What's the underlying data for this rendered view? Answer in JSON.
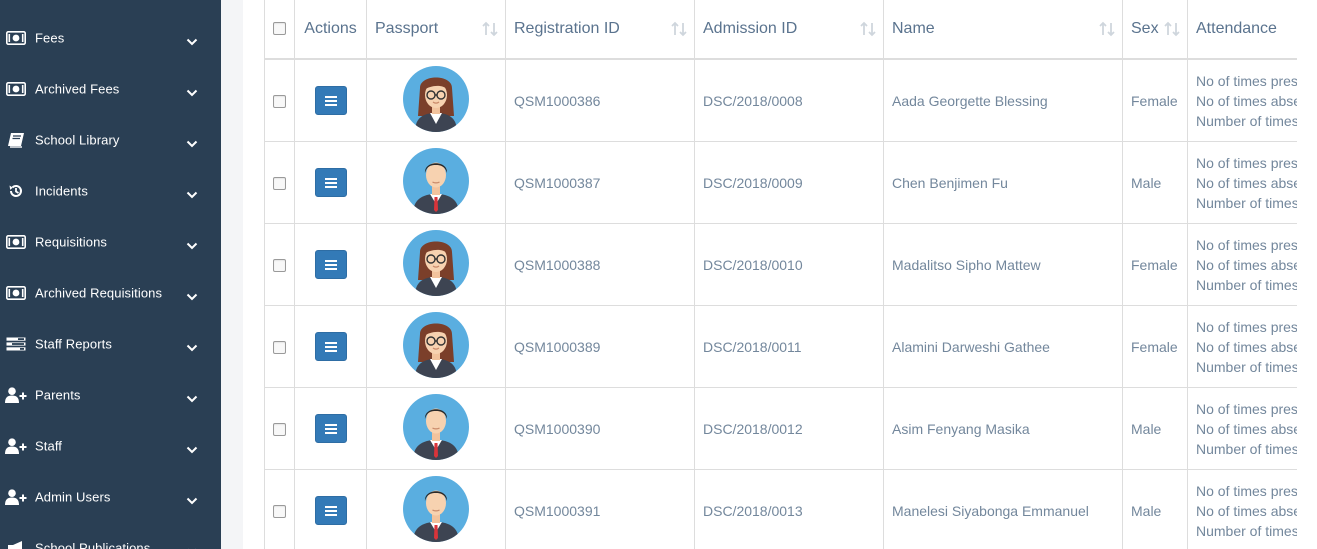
{
  "sidebar": {
    "items": [
      {
        "label": "Fees",
        "icon": "money-icon"
      },
      {
        "label": "Archived Fees",
        "icon": "money-icon"
      },
      {
        "label": "School Library",
        "icon": "book-icon"
      },
      {
        "label": "Incidents",
        "icon": "history-icon"
      },
      {
        "label": "Requisitions",
        "icon": "money-icon"
      },
      {
        "label": "Archived Requisitions",
        "icon": "money-icon"
      },
      {
        "label": "Staff Reports",
        "icon": "tasks-icon"
      },
      {
        "label": "Parents",
        "icon": "user-plus-icon"
      },
      {
        "label": "Staff",
        "icon": "user-plus-icon"
      },
      {
        "label": "Admin Users",
        "icon": "user-plus-icon"
      },
      {
        "label": "School Publications",
        "icon": "bullhorn-icon"
      }
    ]
  },
  "table": {
    "headers": {
      "actions": "Actions",
      "passport": "Passport",
      "registration_id": "Registration ID",
      "admission_id": "Admission ID",
      "name": "Name",
      "sex": "Sex",
      "attendance": "Attendance"
    },
    "attendance_lines": [
      "No of times present",
      "No of times absent",
      "Number of times"
    ],
    "rows": [
      {
        "registration_id": "QSM1000386",
        "admission_id": "DSC/2018/0008",
        "name": "Aada Georgette Blessing",
        "sex": "Female",
        "avatar": "female-avatar-icon"
      },
      {
        "registration_id": "QSM1000387",
        "admission_id": "DSC/2018/0009",
        "name": "Chen Benjimen Fu",
        "sex": "Male",
        "avatar": "male-avatar-icon"
      },
      {
        "registration_id": "QSM1000388",
        "admission_id": "DSC/2018/0010",
        "name": "Madalitso Sipho Mattew",
        "sex": "Female",
        "avatar": "female-avatar-icon"
      },
      {
        "registration_id": "QSM1000389",
        "admission_id": "DSC/2018/0011",
        "name": "Alamini Darweshi Gathee",
        "sex": "Female",
        "avatar": "female-avatar-icon"
      },
      {
        "registration_id": "QSM1000390",
        "admission_id": "DSC/2018/0012",
        "name": "Asim Fenyang Masika",
        "sex": "Male",
        "avatar": "male-avatar-icon"
      },
      {
        "registration_id": "QSM1000391",
        "admission_id": "DSC/2018/0013",
        "name": "Manelesi Siyabonga Emmanuel",
        "sex": "Male",
        "avatar": "male-avatar-icon"
      }
    ]
  },
  "colors": {
    "sidebar_bg": "#2a3f54",
    "action_button": "#337ab7",
    "avatar_bg": "#5aaee0",
    "table_text": "#73879c"
  }
}
